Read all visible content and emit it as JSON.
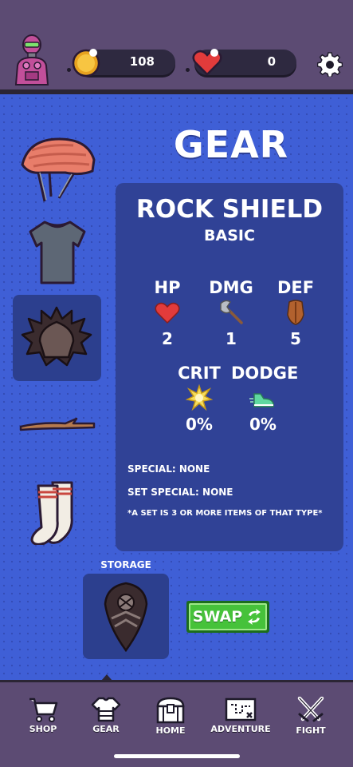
{
  "header": {
    "coins": "108",
    "hearts": "0"
  },
  "page": {
    "title": "GEAR"
  },
  "equipment_slots": [
    {
      "slot": "helmet",
      "icon": "helmet-icon"
    },
    {
      "slot": "shirt",
      "icon": "shirt-icon"
    },
    {
      "slot": "shield",
      "icon": "spiky-shield-icon",
      "selected": true
    },
    {
      "slot": "weapon",
      "icon": "stick-icon"
    },
    {
      "slot": "socks",
      "icon": "socks-icon"
    }
  ],
  "item": {
    "name": "ROCK SHIELD",
    "rarity": "BASIC",
    "stats": {
      "hp": {
        "label": "HP",
        "value": "2",
        "icon": "heart-icon"
      },
      "dmg": {
        "label": "DMG",
        "value": "1",
        "icon": "axe-icon"
      },
      "def": {
        "label": "DEF",
        "value": "5",
        "icon": "shield-icon"
      },
      "crit": {
        "label": "CRIT",
        "value": "0%",
        "icon": "burst-icon"
      },
      "dodge": {
        "label": "DODGE",
        "value": "0%",
        "icon": "sneaker-icon"
      }
    },
    "special": "SPECIAL: NONE",
    "set_special": "SET SPECIAL: NONE",
    "set_note": "*A SET IS 3 OR MORE ITEMS OF THAT TYPE*"
  },
  "storage": {
    "label": "STORAGE",
    "item_icon": "kite-shield-icon"
  },
  "swap_button": {
    "label": "SWAP"
  },
  "nav": [
    {
      "label": "SHOP",
      "icon": "cart-icon"
    },
    {
      "label": "GEAR",
      "icon": "armor-icon",
      "active": true
    },
    {
      "label": "HOME",
      "icon": "chest-icon"
    },
    {
      "label": "ADVENTURE",
      "icon": "map-icon"
    },
    {
      "label": "FIGHT",
      "icon": "crossed-swords-icon"
    }
  ],
  "colors": {
    "topbar": "#5c4b73",
    "main_bg": "#3f5fd6",
    "panel": "#304296",
    "swap_green": "#46c23a"
  }
}
